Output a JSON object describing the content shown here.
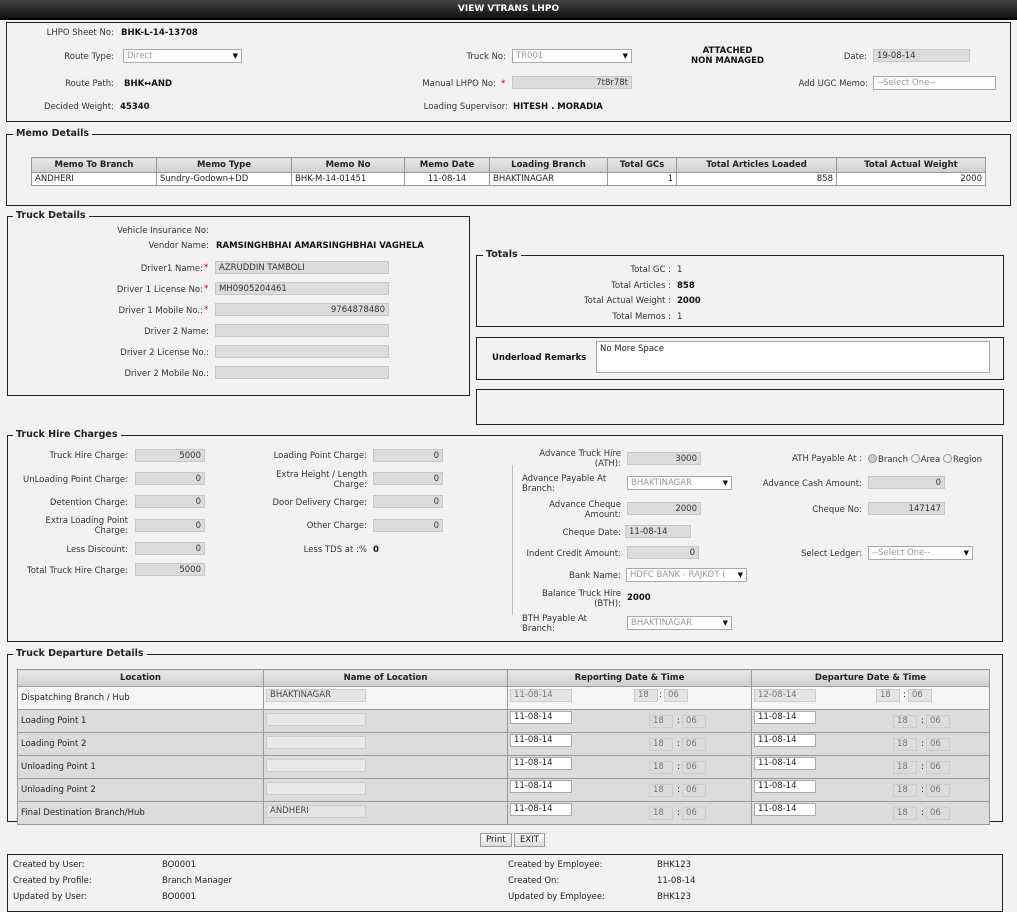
{
  "title": "VIEW VTRANS LHPO",
  "header": {
    "lhpo_sheet_no_label": "LHPO Sheet No:",
    "lhpo_sheet_no": "BHK-L-14-13708",
    "route_type_label": "Route Type:",
    "route_type": "Direct",
    "truck_no_label": "Truck No:",
    "truck_no": "TR001",
    "attached_line1": "ATTACHED",
    "attached_line2": "NON MANAGED",
    "date_label": "Date:",
    "date": "19-08-14",
    "route_path_label": "Route Path:",
    "route_path": "BHK↔AND",
    "manual_lhpo_label": "Manual LHPO No:",
    "manual_lhpo": "7t8r78t",
    "add_ugc_label": "Add UGC Memo:",
    "add_ugc_placeholder": "--Select One--",
    "decided_weight_label": "Decided Weight:",
    "decided_weight": "45340",
    "loading_supervisor_label": "Loading Supervisor:",
    "loading_supervisor": "HITESH . MORADIA"
  },
  "memo": {
    "legend": "Memo Details",
    "columns": [
      "Memo To Branch",
      "Memo Type",
      "Memo No",
      "Memo Date",
      "Loading Branch",
      "Total GCs",
      "Total Articles Loaded",
      "Total Actual Weight"
    ],
    "rows": [
      [
        "ANDHERI",
        "Sundry-Godown+DD",
        "BHK-M-14-01451",
        "11-08-14",
        "BHAKTINAGAR",
        "1",
        "858",
        "2000"
      ]
    ]
  },
  "truck": {
    "legend": "Truck Details",
    "insurance_label": "Vehicle Insurance No:",
    "vendor_label": "Vendor Name:",
    "vendor": "RAMSINGHBHAI AMARSINGHBHAI VAGHELA",
    "driver1_name_label": "Driver1 Name:",
    "driver1_name": "AZRUDDIN TAMBOLI",
    "driver1_license_label": "Driver 1 License No:",
    "driver1_license": "MH0905204461",
    "driver1_mobile_label": "Driver 1 Mobile No.:",
    "driver1_mobile": "9764878480",
    "driver2_name_label": "Driver 2 Name:",
    "driver2_license_label": "Driver 2 License No.:",
    "driver2_mobile_label": "Driver 2 Mobile No.:",
    "star": "*"
  },
  "totals": {
    "legend": "Totals",
    "gc_label": "Total GC :",
    "gc": "1",
    "articles_label": "Total Articles :",
    "articles": "858",
    "weight_label": "Total Actual Weight :",
    "weight": "2000",
    "memos_label": "Total Memos :",
    "memos": "1"
  },
  "underload": {
    "label": "Underload Remarks",
    "value": "No More Space"
  },
  "hire": {
    "legend": "Truck Hire Charges",
    "truck_hire_label": "Truck Hire Charge:",
    "truck_hire": "5000",
    "unloading_label": "UnLoading Point Charge:",
    "unloading": "0",
    "detention_label": "Detention Charge:",
    "detention": "0",
    "extra_loading_label1": "Extra Loading Point",
    "extra_loading_label2": "Charge:",
    "extra_loading": "0",
    "less_discount_label": "Less Discount:",
    "less_discount": "0",
    "total_label": "Total Truck Hire Charge:",
    "total": "5000",
    "loading_point_label": "Loading Point Charge:",
    "loading_point": "0",
    "extra_height_label1": "Extra Height / Length",
    "extra_height_label2": "Charge:",
    "extra_height": "0",
    "door_delivery_label": "Door Delivery Charge:",
    "door_delivery": "0",
    "other_label": "Other Charge:",
    "other": "0",
    "less_tds_label": "Less TDS at :%",
    "less_tds": "0",
    "adv_hire_label1": "Advance Truck Hire",
    "adv_hire_label2": "(ATH):",
    "adv_hire": "3000",
    "adv_payable_label1": "Advance Payable At",
    "adv_payable_label2": "Branch:",
    "adv_payable": "BHAKTINAGAR",
    "adv_cheque_label1": "Advance Cheque",
    "adv_cheque_label2": "Amount:",
    "adv_cheque": "2000",
    "cheque_date_label": "Cheque Date:",
    "cheque_date": "11-08-14",
    "indent_label": "Indent Credit Amount:",
    "indent": "0",
    "bank_label": "Bank Name:",
    "bank": "HDFC BANK - RAJKOT (",
    "balance_label1": "Balance Truck Hire",
    "balance_label2": "(BTH):",
    "balance": "2000",
    "bth_label1": "BTH Payable At",
    "bth_label2": "Branch:",
    "bth": "BHAKTINAGAR",
    "ath_payable_label": "ATH Payable At :",
    "radio_branch": "Branch",
    "radio_area": "Area",
    "radio_region": "Region",
    "adv_cash_label": "Advance Cash Amount:",
    "adv_cash": "0",
    "cheque_no_label": "Cheque No:",
    "cheque_no": "147147",
    "ledger_label": "Select Ledger:",
    "ledger_placeholder": "--Select One--"
  },
  "departure": {
    "legend": "Truck Departure Details",
    "columns": [
      "Location",
      "Name of Location",
      "Reporting Date & Time",
      "Departure Date & Time"
    ],
    "rows": [
      {
        "location": "Dispatching Branch / Hub",
        "name": "BHAKTINAGAR",
        "rep_date": "11-08-14",
        "rep_h": "18",
        "rep_m": "06",
        "dep_date": "12-08-14",
        "dep_h": "18",
        "dep_m": "06"
      },
      {
        "location": "Loading Point 1",
        "name": "",
        "rep_date": "11-08-14",
        "rep_h": "18",
        "rep_m": "06",
        "dep_date": "11-08-14",
        "dep_h": "18",
        "dep_m": "06"
      },
      {
        "location": "Loading Point 2",
        "name": "",
        "rep_date": "11-08-14",
        "rep_h": "18",
        "rep_m": "06",
        "dep_date": "11-08-14",
        "dep_h": "18",
        "dep_m": "06"
      },
      {
        "location": "Unloading Point 1",
        "name": "",
        "rep_date": "11-08-14",
        "rep_h": "18",
        "rep_m": "06",
        "dep_date": "11-08-14",
        "dep_h": "18",
        "dep_m": "06"
      },
      {
        "location": "Unloading Point 2",
        "name": "",
        "rep_date": "11-08-14",
        "rep_h": "18",
        "rep_m": "06",
        "dep_date": "11-08-14",
        "dep_h": "18",
        "dep_m": "06"
      },
      {
        "location": "Final Destination Branch/Hub",
        "name": "ANDHERI",
        "rep_date": "11-08-14",
        "rep_h": "18",
        "rep_m": "06",
        "dep_date": "11-08-14",
        "dep_h": "18",
        "dep_m": "06"
      }
    ]
  },
  "buttons": {
    "print": "Print",
    "exit": "EXIT"
  },
  "footer": {
    "created_by_user_label": "Created by User:",
    "created_by_user": "BO0001",
    "created_by_profile_label": "Created by Profile:",
    "created_by_profile": "Branch Manager",
    "updated_by_user_label": "Updated by User:",
    "updated_by_user": "BO0001",
    "created_by_employee_label": "Created by Employee:",
    "created_by_employee": "BHK123",
    "created_on_label": "Created On:",
    "created_on": "11-08-14",
    "updated_by_employee_label": "Updated by Employee:",
    "updated_by_employee": "BHK123"
  }
}
